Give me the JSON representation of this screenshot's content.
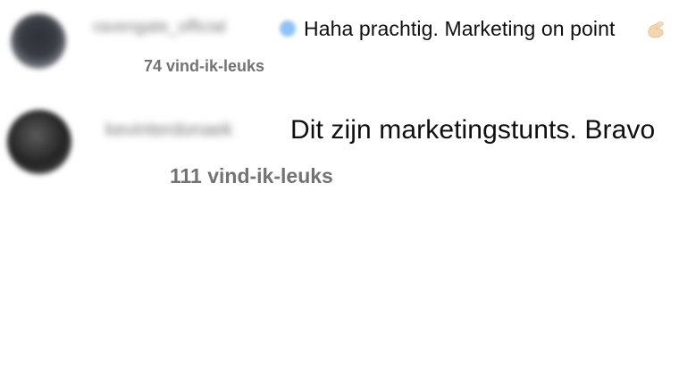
{
  "comments": [
    {
      "username": "ravengate_official",
      "verified": true,
      "text": "Haha prachtig. Marketing on point",
      "emoji": "pinching-hand",
      "likes": "74 vind-ik-leuks"
    },
    {
      "username": "kevinterdonaek",
      "verified": false,
      "text": "Dit zijn marketingstunts. Bravo",
      "likes": "111 vind-ik-leuks"
    }
  ]
}
